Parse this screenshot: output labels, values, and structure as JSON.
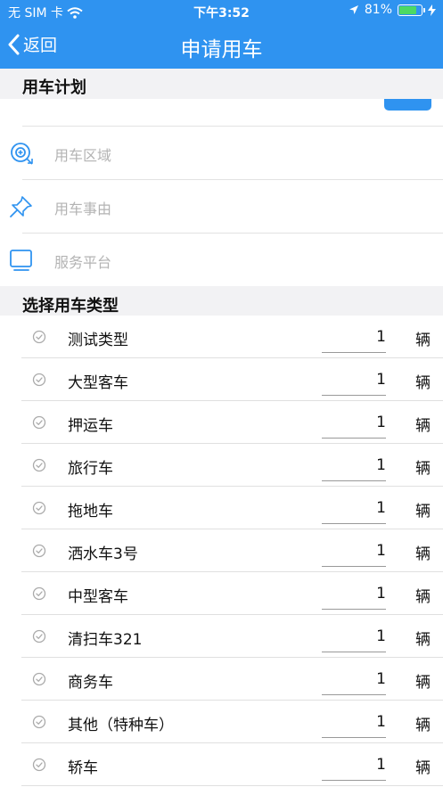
{
  "status_bar": {
    "carrier": "无 SIM 卡",
    "time": "下午3:52",
    "battery": "81%",
    "battery_level": 0.81
  },
  "nav": {
    "back_label": "返回",
    "title": "申请用车"
  },
  "plan_section": {
    "title": "用车计划"
  },
  "form": {
    "area_placeholder": "用车区域",
    "reason_placeholder": "用车事由",
    "platform_placeholder": "服务平台"
  },
  "type_section": {
    "title": "选择用车类型"
  },
  "vehicles": [
    {
      "name": "测试类型",
      "qty": "1",
      "unit": "辆"
    },
    {
      "name": "大型客车",
      "qty": "1",
      "unit": "辆"
    },
    {
      "name": "押运车",
      "qty": "1",
      "unit": "辆"
    },
    {
      "name": "旅行车",
      "qty": "1",
      "unit": "辆"
    },
    {
      "name": "拖地车",
      "qty": "1",
      "unit": "辆"
    },
    {
      "name": "洒水车3号",
      "qty": "1",
      "unit": "辆"
    },
    {
      "name": "中型客车",
      "qty": "1",
      "unit": "辆"
    },
    {
      "name": "清扫车321",
      "qty": "1",
      "unit": "辆"
    },
    {
      "name": "商务车",
      "qty": "1",
      "unit": "辆"
    },
    {
      "name": "其他（特种车）",
      "qty": "1",
      "unit": "辆"
    },
    {
      "name": "轿车",
      "qty": "1",
      "unit": "辆"
    }
  ],
  "colors": {
    "primary": "#2f93f0",
    "section_bg": "#f2f2f4",
    "placeholder": "#b3b3b3"
  }
}
